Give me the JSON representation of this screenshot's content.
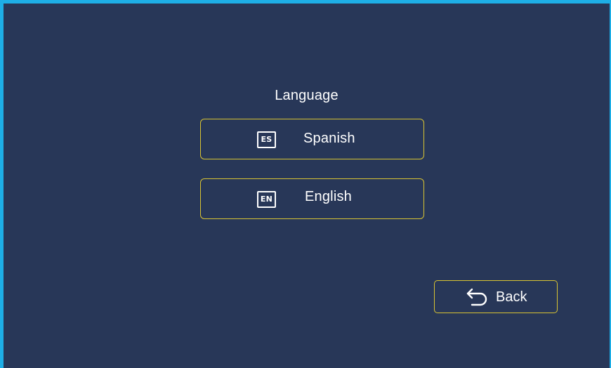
{
  "screen": {
    "title": "Language"
  },
  "languages": [
    {
      "code": "ES",
      "label": "Spanish"
    },
    {
      "code": "EN",
      "label": "English"
    }
  ],
  "back": {
    "label": "Back",
    "icon": "back-arrow-icon"
  },
  "colors": {
    "background": "#283758",
    "frame": "#1eaee6",
    "button_border": "#d9c433",
    "text": "#ffffff"
  }
}
